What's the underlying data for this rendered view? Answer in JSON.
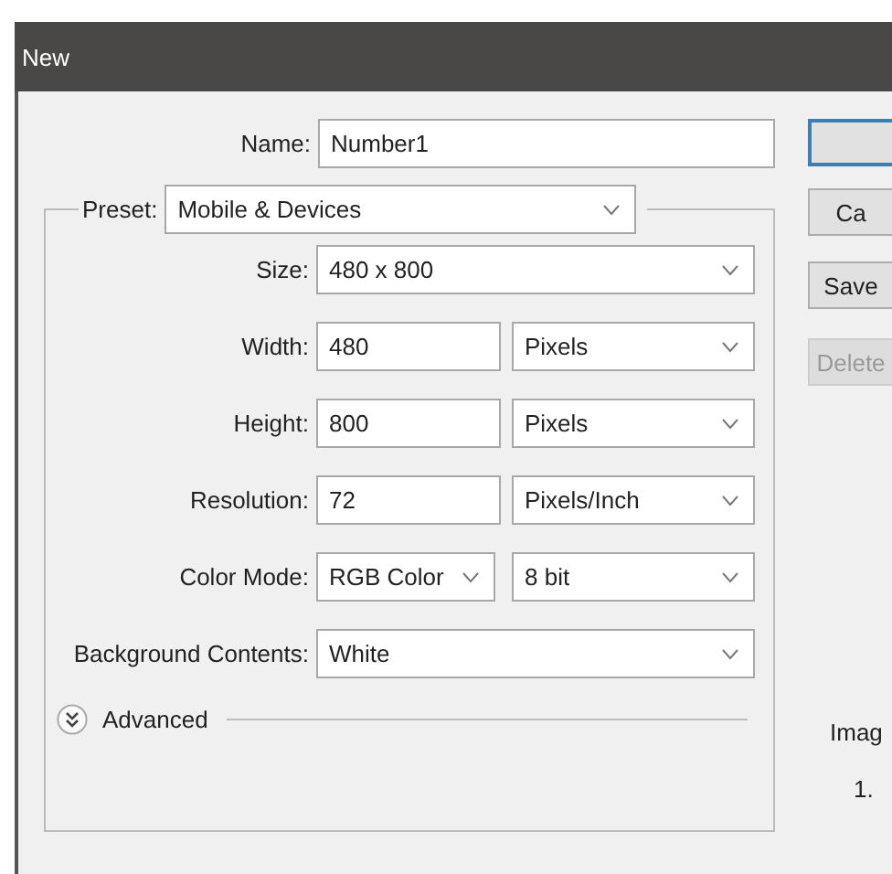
{
  "window": {
    "title": "New"
  },
  "name": {
    "label": "Name:",
    "value": "Number1"
  },
  "preset": {
    "label": "Preset:",
    "value": "Mobile & Devices"
  },
  "fields": [
    {
      "kind": "select",
      "label": "Size:",
      "value": "480 x 800"
    },
    {
      "kind": "input-unit",
      "label": "Width:",
      "value": "480",
      "unit": "Pixels"
    },
    {
      "kind": "input-unit",
      "label": "Height:",
      "value": "800",
      "unit": "Pixels"
    },
    {
      "kind": "input-unit",
      "label": "Resolution:",
      "value": "72",
      "unit": "Pixels/Inch"
    },
    {
      "kind": "select-pair",
      "label": "Color Mode:",
      "value": "RGB Color",
      "unit": "8 bit"
    },
    {
      "kind": "select",
      "label": "Background Contents:",
      "value": "White"
    }
  ],
  "advanced": {
    "label": "Advanced",
    "expanded": false
  },
  "buttons": [
    {
      "kind": "default",
      "disabled": false
    },
    {
      "kind": "plain",
      "label": "Ca",
      "disabled": false
    },
    {
      "kind": "plain",
      "label": "Save",
      "disabled": false
    },
    {
      "kind": "plain",
      "label": "Delete",
      "disabled": true
    }
  ],
  "image_size": {
    "label": "Imag",
    "value": "1."
  }
}
